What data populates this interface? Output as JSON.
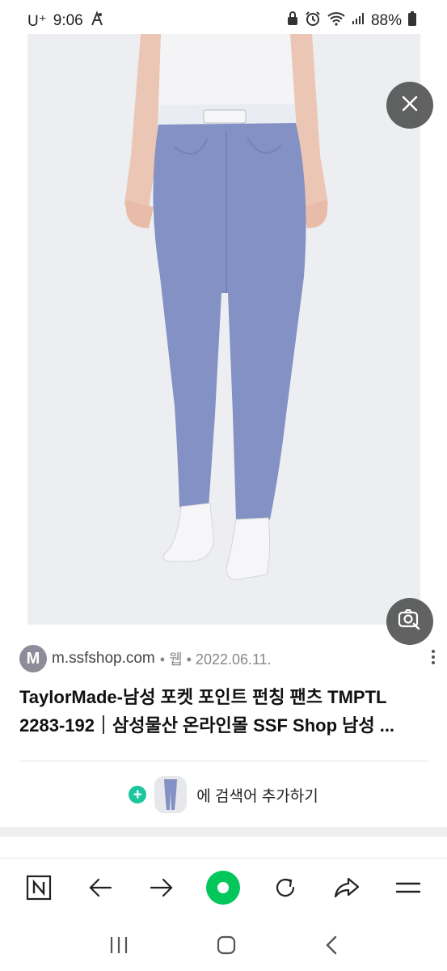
{
  "status": {
    "carrier": "U⁺",
    "time": "9:06",
    "battery": "88%",
    "icons": [
      "golf-notification-icon",
      "lock-icon",
      "alarm-icon",
      "wifi-icon",
      "signal-icon",
      "battery-icon"
    ]
  },
  "image_viewer": {
    "close_icon": "close-icon",
    "lens_icon": "image-search-icon"
  },
  "result": {
    "favicon_letter": "M",
    "domain": "m.ssfshop.com",
    "meta": "• 웹 • 2022.06.11.",
    "title": "TaylorMade-남성 포켓 포인트 펀칭 팬츠 TMPTL 2283-192｜삼성물산 온라인몰 SSF Shop 남성 ...",
    "add_search_label": "에 검색어 추가하기"
  },
  "bottom_nav": {
    "items": [
      "naver-home-icon",
      "back-arrow-icon",
      "forward-arrow-icon",
      "green-dot-button",
      "refresh-icon",
      "share-icon",
      "menu-icon"
    ]
  },
  "system_nav": [
    "recents-icon",
    "home-icon",
    "back-icon"
  ],
  "colors": {
    "accent_green": "#03c75a",
    "plus_teal": "#1ec6a0",
    "pants_blue": "#8491c4"
  }
}
